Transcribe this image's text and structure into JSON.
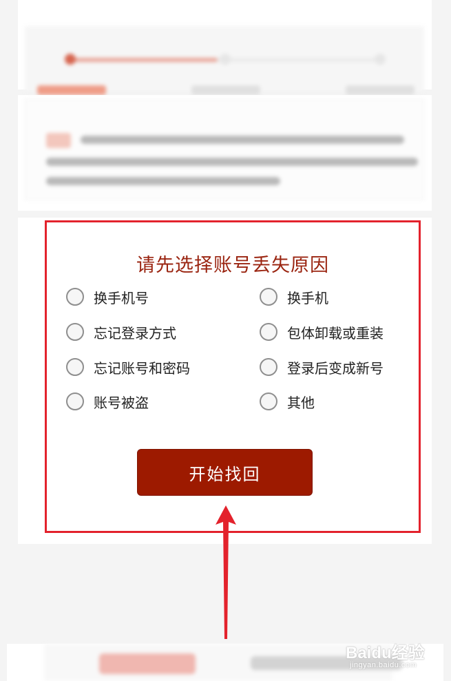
{
  "reason_form": {
    "title": "请先选择账号丢失原因",
    "options": [
      {
        "label": "换手机号"
      },
      {
        "label": "换手机"
      },
      {
        "label": "忘记登录方式"
      },
      {
        "label": "包体卸载或重装"
      },
      {
        "label": "忘记账号和密码"
      },
      {
        "label": "登录后变成新号"
      },
      {
        "label": "账号被盗"
      },
      {
        "label": "其他"
      }
    ],
    "submit_label": "开始找回"
  },
  "annotation": {
    "frame_color": "#e3222c",
    "arrow_color": "#e3222c"
  },
  "theme": {
    "accent": "#9d1a00",
    "title_color": "#9a2410"
  },
  "watermark": {
    "brand": "Baidu经验",
    "sub": "jingyan.baidu.com"
  }
}
